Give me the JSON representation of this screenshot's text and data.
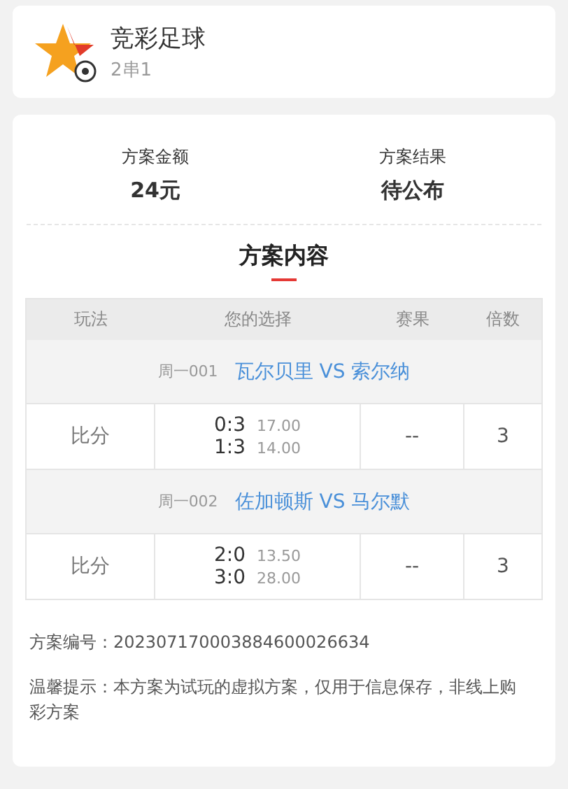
{
  "header": {
    "title": "竞彩足球",
    "subtitle": "2串1"
  },
  "summary": [
    {
      "label": "方案金额",
      "value": "24元"
    },
    {
      "label": "方案结果",
      "value": "待公布"
    }
  ],
  "content": {
    "title": "方案内容",
    "table": {
      "columns": [
        "玩法",
        "您的选择",
        "赛果",
        "倍数"
      ],
      "matches": [
        {
          "code": "周一001",
          "teams": "瓦尔贝里 VS 索尔纳",
          "play": "比分",
          "choices": [
            {
              "score": "0:3",
              "odds": "17.00"
            },
            {
              "score": "1:3",
              "odds": "14.00"
            }
          ],
          "result": "--",
          "multiple": "3"
        },
        {
          "code": "周一002",
          "teams": "佐加顿斯 VS 马尔默",
          "play": "比分",
          "choices": [
            {
              "score": "2:0",
              "odds": "13.50"
            },
            {
              "score": "3:0",
              "odds": "28.00"
            }
          ],
          "result": "--",
          "multiple": "3"
        }
      ]
    }
  },
  "plan_number": "方案编号：202307170003884600026634",
  "notice": "温馨提示：本方案为试玩的虚拟方案，仅用于信息保存，非线上购彩方案"
}
